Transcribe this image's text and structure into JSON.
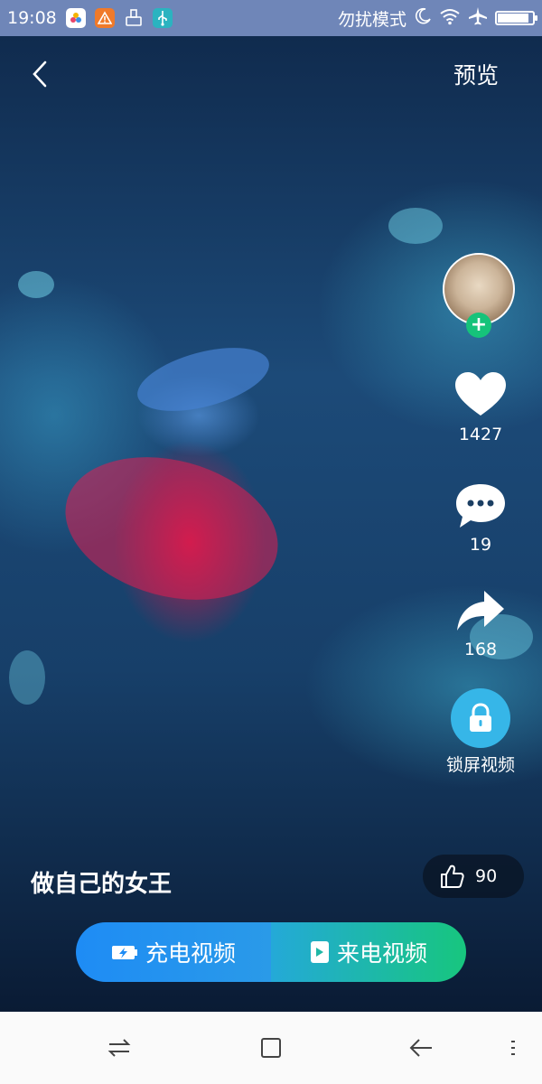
{
  "status_bar": {
    "time": "19:08",
    "mode_text": "勿扰模式",
    "battery_level_pct": 90
  },
  "header": {
    "back_icon": "chevron-left-icon",
    "preview_label": "预览"
  },
  "rail": {
    "avatar_icon": "user-avatar",
    "follow_icon": "plus-icon",
    "likes": "1427",
    "comments": "19",
    "shares": "168",
    "lock_label": "锁屏视频"
  },
  "video": {
    "title": "做自己的女王",
    "thumb_count": "90"
  },
  "actions": {
    "charge_label": "充电视频",
    "call_label": "来电视频"
  },
  "colors": {
    "status_bar": "#6f86b8",
    "follow_badge": "#16c37a",
    "lock_button": "#36b6e8",
    "action_left": "#1e8cf5",
    "action_right": "#17c67e"
  }
}
